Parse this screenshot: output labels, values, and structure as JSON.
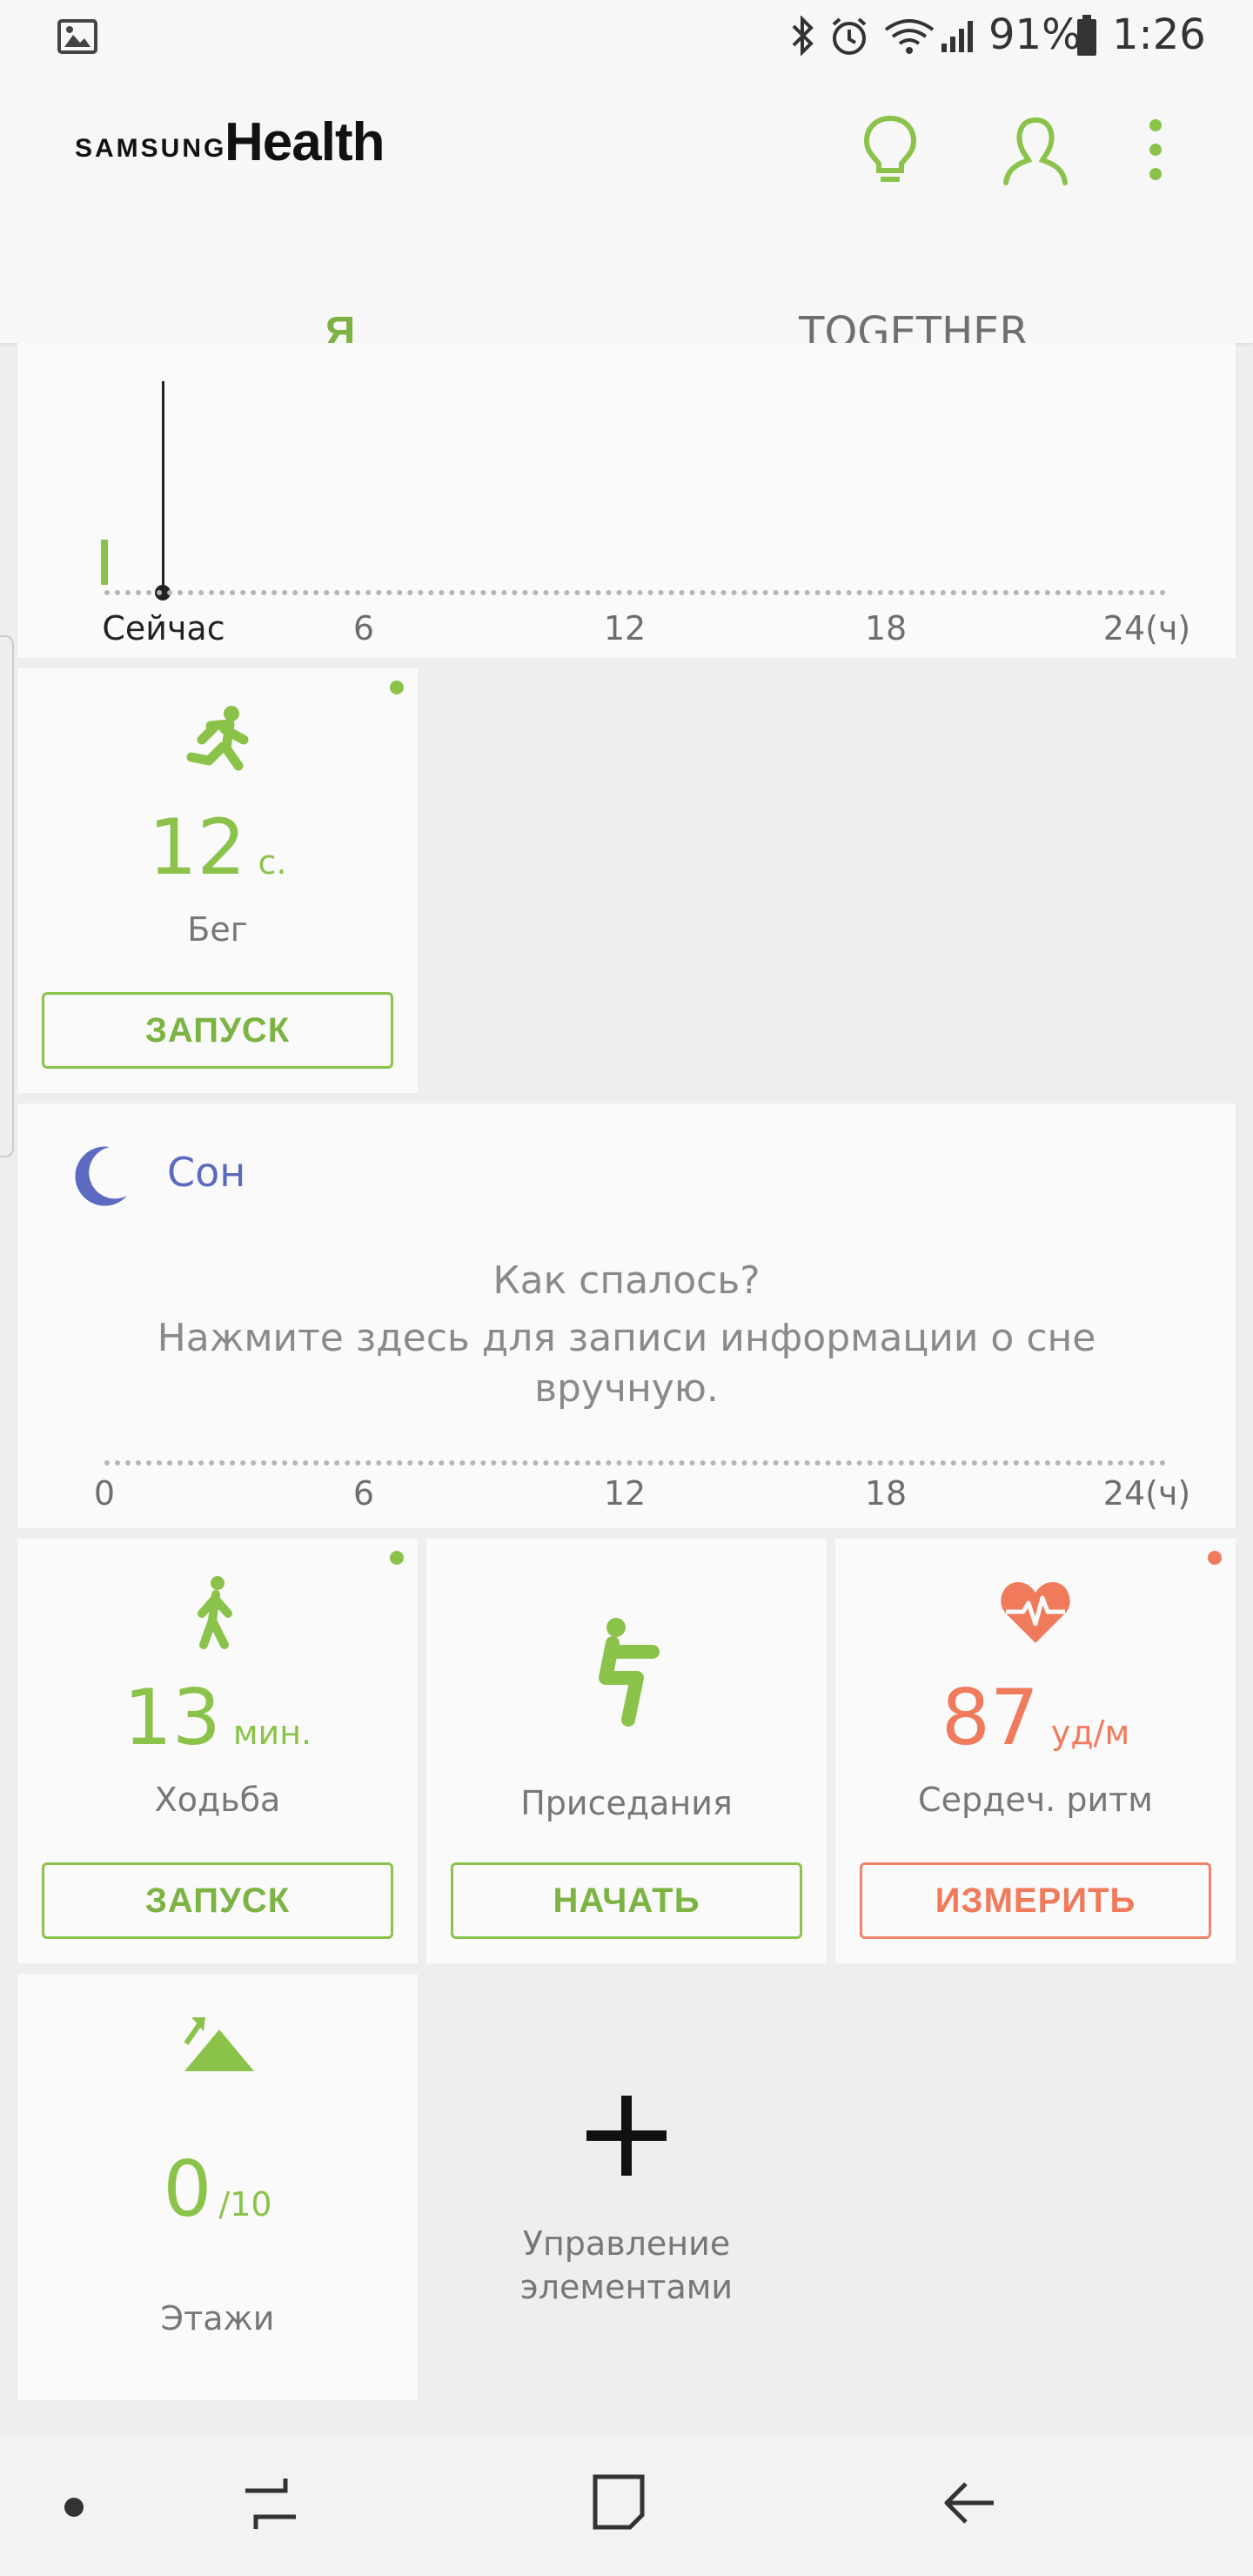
{
  "status_bar": {
    "battery": "91%",
    "time": "1:26",
    "icons": [
      "image-icon",
      "bluetooth-icon",
      "alarm-icon",
      "wifi-icon",
      "signal-icon",
      "battery-icon"
    ]
  },
  "header": {
    "brand_small": "SAMSUNG",
    "brand_large": "Health",
    "actions": [
      "lightbulb-icon",
      "profile-icon",
      "more-options-icon"
    ]
  },
  "tabs": [
    {
      "label": "Я",
      "selected": true
    },
    {
      "label": "TOGETHER",
      "selected": false
    }
  ],
  "activity_timeline": {
    "labels": [
      "Сейчас",
      "6",
      "12",
      "18",
      "24(ч)"
    ]
  },
  "running_card": {
    "value": "12",
    "unit": "с.",
    "label": "Бег",
    "button": "ЗАПУСК",
    "icon": "running-icon"
  },
  "sleep_card": {
    "title": "Сон",
    "prompt": "Как спалось?",
    "hint_line1": "Нажмите здесь для записи информации о сне",
    "hint_line2": "вручную.",
    "axis_labels": [
      "0",
      "6",
      "12",
      "18",
      "24(ч)"
    ],
    "icon": "moon-icon"
  },
  "walking_card": {
    "value": "13",
    "unit": "мин.",
    "label": "Ходьба",
    "button": "ЗАПУСК",
    "icon": "walking-icon"
  },
  "squats_card": {
    "label": "Приседания",
    "button": "НАЧАТЬ",
    "icon": "squat-icon"
  },
  "heart_card": {
    "value": "87",
    "unit": "уд/м",
    "label": "Сердеч. ритм",
    "button": "ИЗМЕРИТЬ",
    "icon": "heart-rate-icon"
  },
  "floors_card": {
    "value": "0",
    "goal": "/10",
    "label": "Этажи",
    "icon": "floors-icon"
  },
  "manage_card": {
    "label_line1": "Управление",
    "label_line2": "элементами",
    "icon": "plus-icon"
  },
  "colors": {
    "accent_green": "#8bc34a",
    "heart_red": "#f07a5c",
    "sleep_blue": "#5c6bc0"
  }
}
